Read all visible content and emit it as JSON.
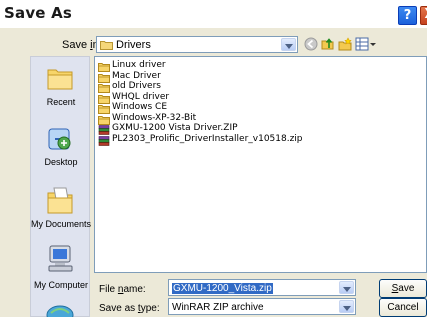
{
  "window": {
    "title": "Save As"
  },
  "titlebar_buttons": {
    "help": "?",
    "close": "X"
  },
  "save_in": {
    "label_prefix": "Save ",
    "label_hotkey": "i",
    "label_suffix": "n:",
    "value": "Drivers"
  },
  "toolbar": {
    "icons": [
      "back-icon",
      "up-folder-icon",
      "new-folder-icon",
      "views-menu-icon"
    ]
  },
  "places": [
    {
      "label": "Recent",
      "icon": "recent-icon"
    },
    {
      "label": "Desktop",
      "icon": "desktop-icon"
    },
    {
      "label": "My Documents",
      "icon": "my-documents-icon"
    },
    {
      "label": "My Computer",
      "icon": "my-computer-icon"
    }
  ],
  "files": [
    {
      "name": "Linux driver",
      "type": "folder"
    },
    {
      "name": "Mac Driver",
      "type": "folder"
    },
    {
      "name": "old Drivers",
      "type": "folder"
    },
    {
      "name": "WHQL driver",
      "type": "folder"
    },
    {
      "name": "Windows CE",
      "type": "folder"
    },
    {
      "name": "Windows-XP-32-Bit",
      "type": "folder"
    },
    {
      "name": "GXMU-1200 Vista Driver.ZIP",
      "type": "zip"
    },
    {
      "name": "PL2303_Prolific_DriverInstaller_v10518.zip",
      "type": "zip"
    }
  ],
  "file_name": {
    "label_prefix": "File ",
    "label_hotkey": "n",
    "label_suffix": "ame:",
    "value": "GXMU-1200_Vista.zip"
  },
  "save_as_type": {
    "label_prefix": "Save as ",
    "label_hotkey": "t",
    "label_suffix": "ype:",
    "value": "WinRAR ZIP archive"
  },
  "buttons": {
    "save_hotkey": "S",
    "save_rest": "ave",
    "cancel": "Cancel"
  }
}
